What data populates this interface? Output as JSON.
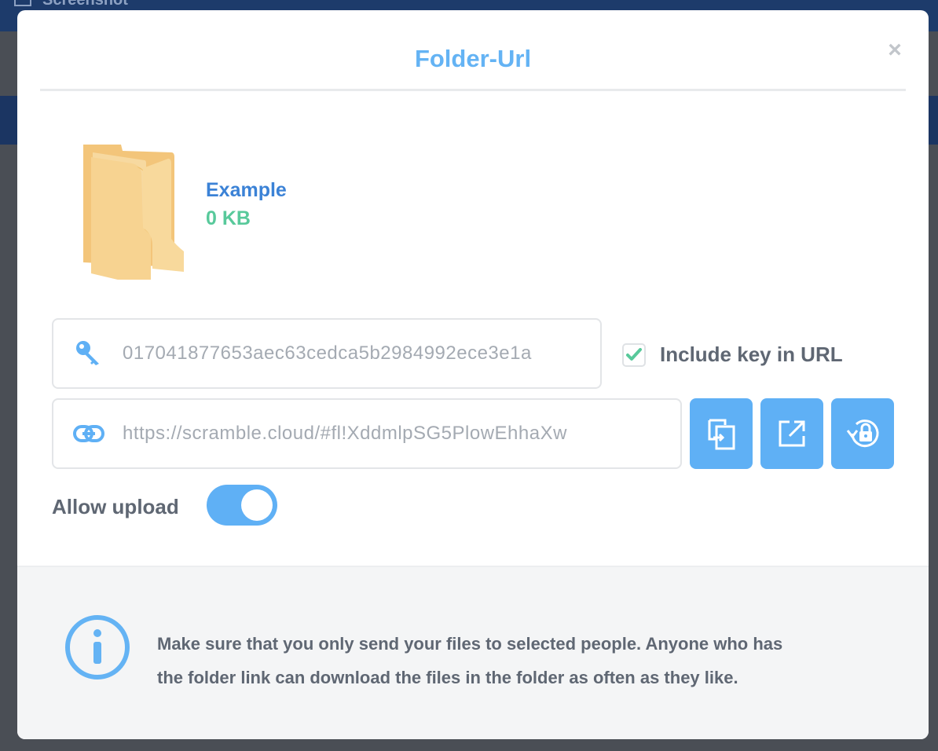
{
  "background": {
    "app_title": "Screenshot"
  },
  "modal": {
    "title": "Folder-Url",
    "close_label": "×"
  },
  "file": {
    "name": "Example",
    "size": "0 KB"
  },
  "key_field": {
    "value": "017041877653aec63cedca5b2984992ece3e1a"
  },
  "include_key": {
    "label": "Include key in URL",
    "checked": true
  },
  "url_field": {
    "value": "https://scramble.cloud/#fl!XddmlpSG5PlowEhhaXw"
  },
  "allow_upload": {
    "label": "Allow upload",
    "enabled": true
  },
  "info": {
    "line1": "Make sure that you only send your files to selected people. Anyone who has",
    "line2": "the folder link can download the files in the folder as often as they like."
  },
  "colors": {
    "accent": "#5fb0f5",
    "title": "#64b3f4",
    "file_name": "#3b82d6",
    "file_size": "#58c99b",
    "check": "#58c99b"
  },
  "icons": {
    "folder": "folder-icon",
    "key": "key-icon",
    "link": "link-icon",
    "copy": "copy-icon",
    "open": "external-link-icon",
    "reset": "lock-reset-icon",
    "info": "info-icon",
    "close": "close-icon",
    "check": "check-icon"
  }
}
